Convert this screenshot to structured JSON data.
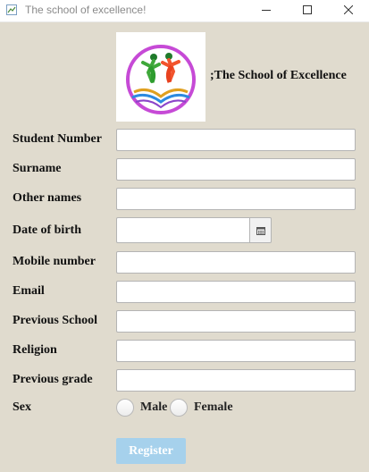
{
  "window": {
    "title": "The school of excellence!",
    "controls": [
      "minimize-icon",
      "maximize-icon",
      "close-icon"
    ]
  },
  "header": {
    "logo": "school-logo",
    "school_name": ";The School of Excellence"
  },
  "form": {
    "student_number": {
      "label": "Student Number",
      "value": ""
    },
    "surname": {
      "label": "Surname",
      "value": ""
    },
    "other_names": {
      "label": "Other names",
      "value": ""
    },
    "date_of_birth": {
      "label": "Date of birth",
      "value": "",
      "picker_icon": "calendar-icon"
    },
    "mobile_number": {
      "label": "Mobile number",
      "value": ""
    },
    "email": {
      "label": "Email",
      "value": ""
    },
    "previous_school": {
      "label": "Previous School",
      "value": ""
    },
    "religion": {
      "label": "Religion",
      "value": ""
    },
    "previous_grade": {
      "label": "Previous grade",
      "value": ""
    },
    "sex": {
      "label": "Sex",
      "options": [
        {
          "label": "Male",
          "selected": false
        },
        {
          "label": "Female",
          "selected": false
        }
      ]
    },
    "register_label": "Register"
  },
  "colors": {
    "background": "#e0dbce",
    "register_button": "#a6d1ec",
    "register_text": "#ffffff"
  }
}
